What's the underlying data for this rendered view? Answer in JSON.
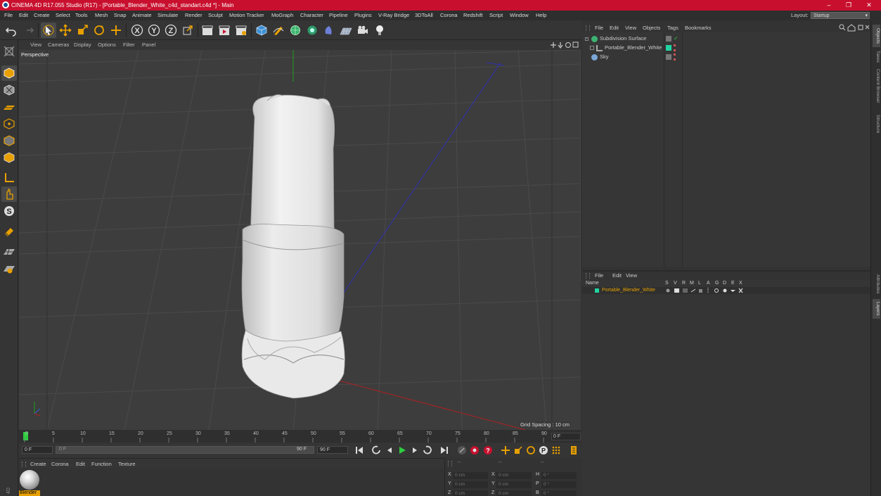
{
  "window": {
    "title": "CINEMA 4D R17.055 Studio (R17) - [Portable_Blender_White_c4d_standart.c4d *] - Main",
    "controls": [
      "–",
      "❐",
      "✕"
    ]
  },
  "menubar": {
    "items": [
      "File",
      "Edit",
      "Create",
      "Select",
      "Tools",
      "Mesh",
      "Snap",
      "Animate",
      "Simulate",
      "Render",
      "Sculpt",
      "Motion Tracker",
      "MoGraph",
      "Character",
      "Pipeline",
      "Plugins",
      "V-Ray Bridge",
      "3DToAll",
      "Corona",
      "Redshift",
      "Script",
      "Window",
      "Help"
    ],
    "layout_label": "Layout:",
    "layout_value": "Startup"
  },
  "viewport": {
    "menu": [
      "View",
      "Cameras",
      "Display",
      "Options",
      "Filter",
      "Panel"
    ],
    "name": "Perspective",
    "grid_spacing": "Grid Spacing : 10 cm"
  },
  "timeline": {
    "ticks": [
      "0",
      "5",
      "10",
      "15",
      "20",
      "25",
      "30",
      "35",
      "40",
      "45",
      "50",
      "55",
      "60",
      "65",
      "70",
      "75",
      "80",
      "85",
      "90"
    ],
    "current_frame": "0 F",
    "start_field": "0 F",
    "range_start": "0 F",
    "range_end": "90 F",
    "end_field": "90 F"
  },
  "material_manager": {
    "menu": [
      "Create",
      "Corona",
      "Edit",
      "Function",
      "Texture"
    ],
    "materials": [
      {
        "name": "Blender"
      }
    ]
  },
  "coordinates": {
    "headers": [
      "--",
      "--",
      "--"
    ],
    "rows": [
      {
        "a": "X",
        "av": "0 cm",
        "b": "X",
        "bv": "0 cm",
        "c": "H",
        "cv": "0 °"
      },
      {
        "a": "Y",
        "av": "0 cm",
        "b": "Y",
        "bv": "0 cm",
        "c": "P",
        "cv": "0 °"
      },
      {
        "a": "Z",
        "av": "0 cm",
        "b": "Z",
        "bv": "0 cm",
        "c": "B",
        "cv": "0 °"
      }
    ]
  },
  "object_manager": {
    "menu": [
      "File",
      "Edit",
      "View",
      "Objects",
      "Tags",
      "Bookmarks"
    ],
    "objects": [
      {
        "name": "Subdivision Surface",
        "color": "#7ec97e"
      },
      {
        "name": "Portable_Blender_White",
        "color": "#aaaaaa"
      },
      {
        "name": "Sky",
        "color": "#7aa7d6"
      }
    ]
  },
  "layer_manager": {
    "menu": [
      "File",
      "Edit",
      "View"
    ],
    "columns": [
      "Name",
      "S",
      "V",
      "R",
      "M",
      "L",
      "A",
      "G",
      "D",
      "E",
      "X"
    ],
    "layers": [
      {
        "name": "Portable_Blender_White",
        "color": "#22d3a0"
      }
    ]
  },
  "right_tabs": [
    "Objects",
    "Takes",
    "Content Browser",
    "Structure",
    "Attributes",
    "Layers"
  ],
  "colors": {
    "title_bar": "#c8102e",
    "accent_orange": "#e8a000",
    "axis_x": "#b02020",
    "axis_y": "#20a020",
    "axis_z": "#3030b0"
  }
}
